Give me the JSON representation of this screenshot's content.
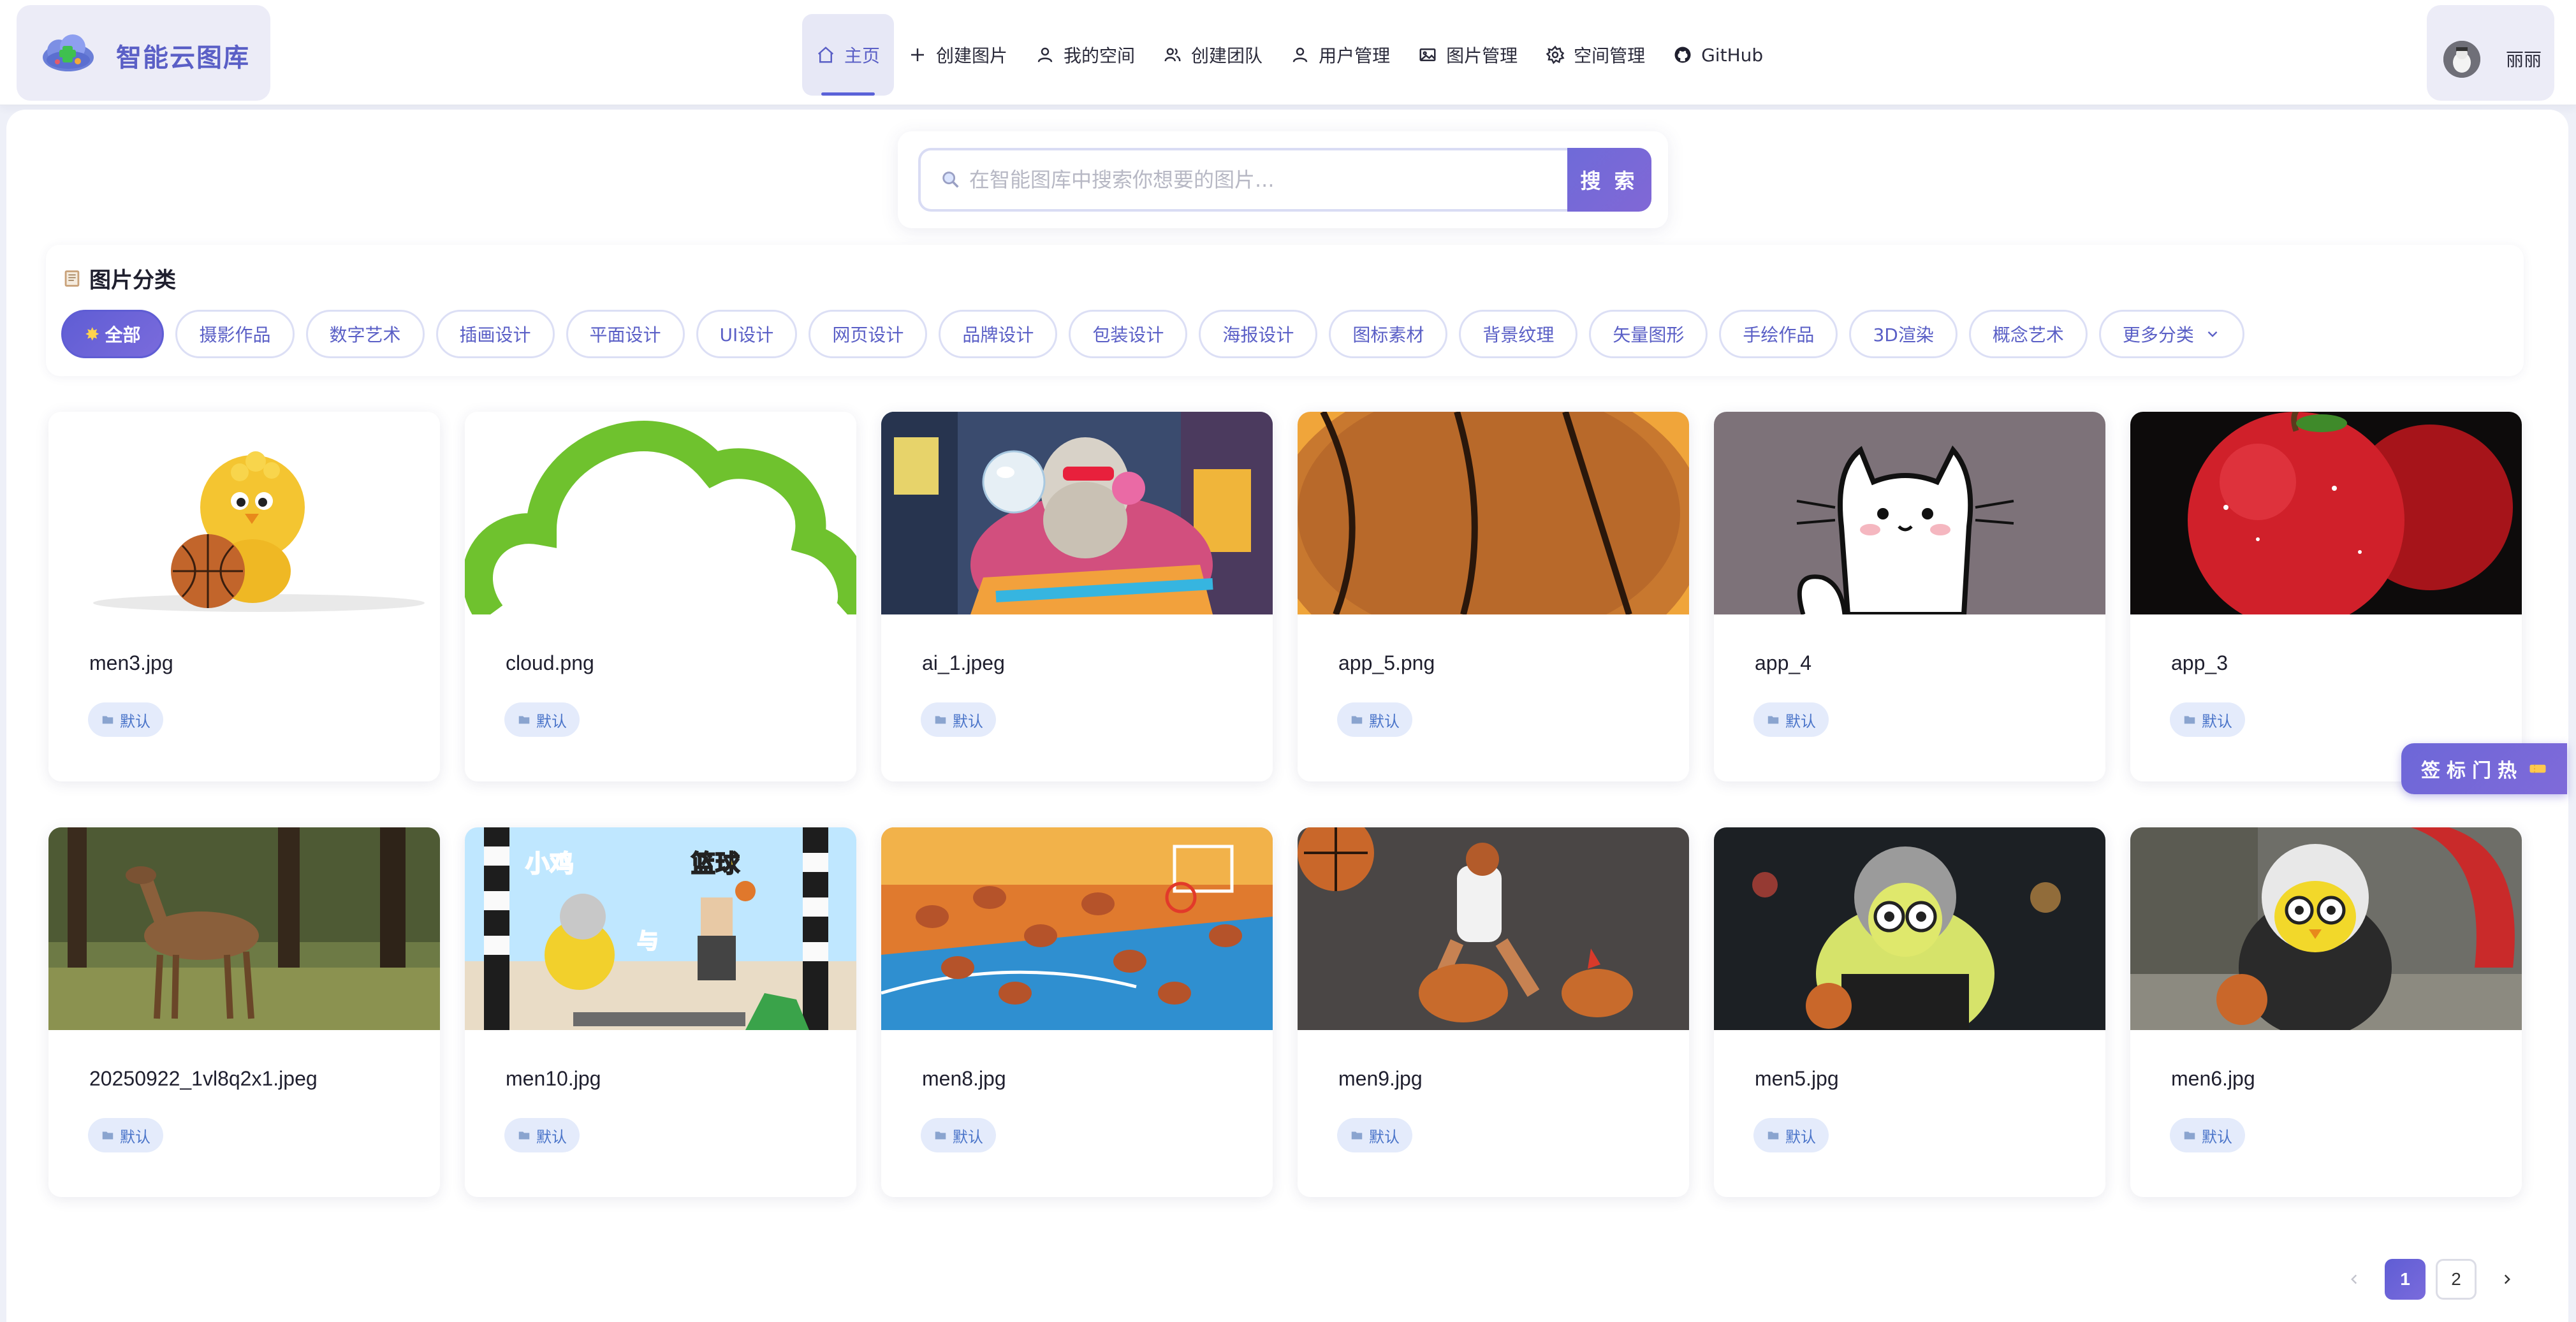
{
  "brand": {
    "title": "智能云图库",
    "logo_icon": "cloud-logo-icon"
  },
  "nav": [
    {
      "label": "主页",
      "icon": "home-icon",
      "active": true
    },
    {
      "label": "创建图片",
      "icon": "plus-icon"
    },
    {
      "label": "我的空间",
      "icon": "user-icon"
    },
    {
      "label": "创建团队",
      "icon": "team-icon"
    },
    {
      "label": "用户管理",
      "icon": "user-icon"
    },
    {
      "label": "图片管理",
      "icon": "image-icon"
    },
    {
      "label": "空间管理",
      "icon": "gear-icon"
    },
    {
      "label": "GitHub",
      "icon": "github-icon"
    }
  ],
  "user": {
    "name": "丽丽"
  },
  "search": {
    "placeholder": "在智能图库中搜索你想要的图片...",
    "button": "搜 索",
    "value": ""
  },
  "categories": {
    "title": "图片分类",
    "items": [
      "全部",
      "摄影作品",
      "数字艺术",
      "插画设计",
      "平面设计",
      "UI设计",
      "网页设计",
      "品牌设计",
      "包装设计",
      "海报设计",
      "图标素材",
      "背景纹理",
      "矢量图形",
      "手绘作品",
      "3D渲染",
      "概念艺术"
    ],
    "active": "全部",
    "more": "更多分类"
  },
  "pictures": [
    {
      "name": "men3.jpg",
      "tag": "默认",
      "thumb": "yellow-chick-basketball"
    },
    {
      "name": "cloud.png",
      "tag": "默认",
      "thumb": "green-cloud-outline"
    },
    {
      "name": "ai_1.jpeg",
      "tag": "默认",
      "thumb": "statue-bubblegum-city"
    },
    {
      "name": "app_5.png",
      "tag": "默认",
      "thumb": "basketball-closeup"
    },
    {
      "name": "app_4",
      "tag": "默认",
      "thumb": "white-cartoon-cat"
    },
    {
      "name": "app_3",
      "tag": "默认",
      "thumb": "red-apples"
    },
    {
      "name": "20250922_1vl8q2x1.jpeg",
      "tag": "默认",
      "thumb": "deer-in-forest"
    },
    {
      "name": "men10.jpg",
      "tag": "默认",
      "thumb": "minecraft-chick-basketball",
      "overlay_text": [
        "小鸡",
        "与",
        "篮球"
      ]
    },
    {
      "name": "men8.jpg",
      "tag": "默认",
      "thumb": "chickens-basketball-court"
    },
    {
      "name": "men9.jpg",
      "tag": "默认",
      "thumb": "player-with-chickens"
    },
    {
      "name": "men5.jpg",
      "tag": "默认",
      "thumb": "duck-toy-glasses-night"
    },
    {
      "name": "men6.jpg",
      "tag": "默认",
      "thumb": "duck-toy-hoodie"
    }
  ],
  "hot_tab": {
    "label": "热门标签"
  },
  "pagination": {
    "current": "1",
    "pages": [
      "1",
      "2"
    ]
  },
  "colors": {
    "accent": "#5f5dd4",
    "tag_bg": "#e4ebfb",
    "tag_text": "#4a74c9"
  }
}
